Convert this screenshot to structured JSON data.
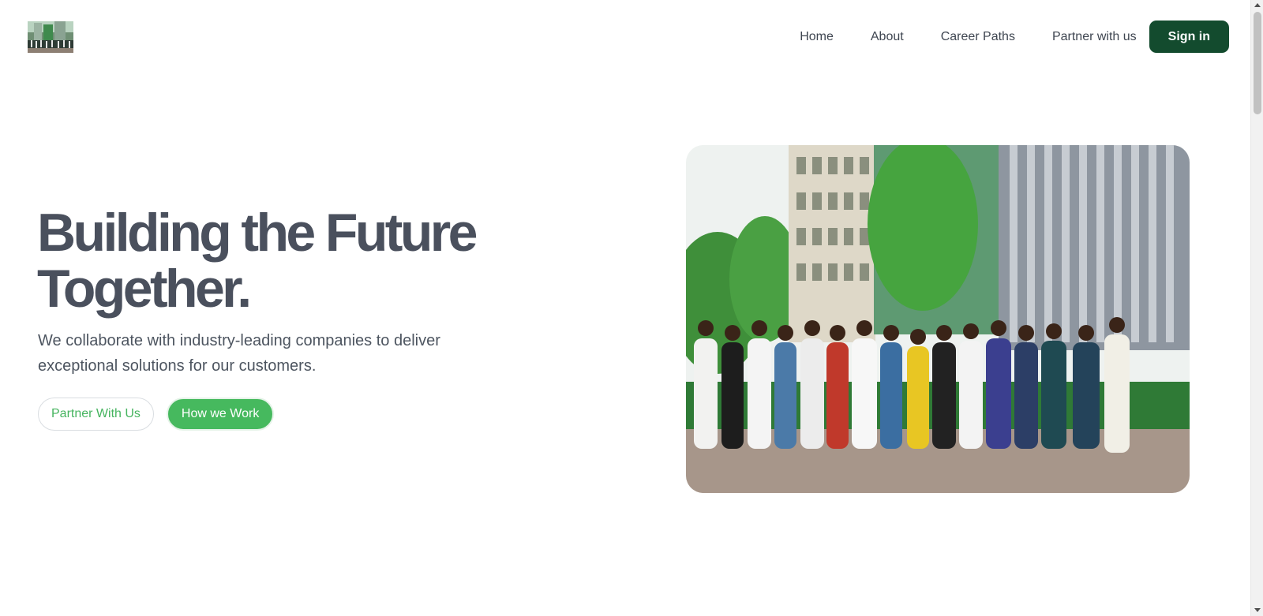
{
  "header": {
    "logo_alt": "logo",
    "nav": [
      {
        "label": "Home"
      },
      {
        "label": "About"
      },
      {
        "label": "Career Paths"
      },
      {
        "label": "Partner with us"
      }
    ],
    "signin_label": "Sign in"
  },
  "hero": {
    "title_line1": "Building the Future",
    "title_line2": "Together.",
    "subtitle": "We collaborate with industry-leading companies to deliver exceptional solutions for our customers.",
    "primary_cta": "Partner With Us",
    "secondary_cta": "How we Work"
  },
  "photo": {
    "alt": "Group photo of students in front of a campus building"
  },
  "colors": {
    "brand_dark_green": "#134b2e",
    "accent_green": "#46b95e",
    "heading": "#4a505d",
    "text": "#4d5560"
  }
}
